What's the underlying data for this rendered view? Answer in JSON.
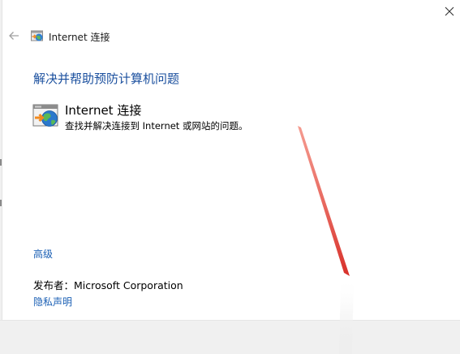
{
  "window": {
    "title": "Internet 连接",
    "close_icon": "close-icon",
    "back_icon": "back-arrow-icon"
  },
  "main": {
    "heading": "解决并帮助预防计算机问题",
    "troubleshooter": {
      "title": "Internet 连接",
      "description": "查找并解决连接到 Internet 或网站的问题。",
      "icon": "internet-connection-icon"
    },
    "advanced_link": "高级",
    "publisher": "发布者：Microsoft Corporation",
    "privacy_link": "隐私声明"
  },
  "colors": {
    "heading": "#1a4f9e",
    "link": "#1a5fb4",
    "footer_bg": "#f0f0f0",
    "annotation_arrow": "#e0403a"
  }
}
